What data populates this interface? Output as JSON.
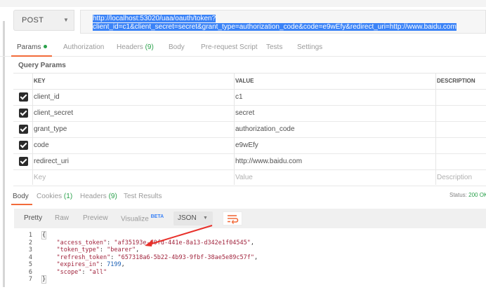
{
  "request": {
    "method": "POST",
    "url_line1": "http://localhost:53020/uaa/oauth/token?",
    "url_line2": "client_id=c1&client_secret=secret&grant_type=authorization_code&code=e9wEfy&redirect_uri=http://www.baidu.com"
  },
  "request_tabs": [
    {
      "label": "Params",
      "active": true,
      "dot": true
    },
    {
      "label": "Authorization"
    },
    {
      "label": "Headers",
      "count": "(9)"
    },
    {
      "label": "Body"
    },
    {
      "label": "Pre-request Script"
    },
    {
      "label": "Tests"
    },
    {
      "label": "Settings"
    }
  ],
  "query_params": {
    "title": "Query Params",
    "headers": {
      "key": "KEY",
      "value": "VALUE",
      "description": "DESCRIPTION"
    },
    "rows": [
      {
        "key": "client_id",
        "value": "c1"
      },
      {
        "key": "client_secret",
        "value": "secret"
      },
      {
        "key": "grant_type",
        "value": "authorization_code"
      },
      {
        "key": "code",
        "value": "e9wEfy"
      },
      {
        "key": "redirect_uri",
        "value": "http://www.baidu.com"
      }
    ],
    "placeholder": {
      "key": "Key",
      "value": "Value",
      "description": "Description"
    }
  },
  "response_tabs": [
    {
      "label": "Body",
      "active": true
    },
    {
      "label": "Cookies",
      "count": "(1)"
    },
    {
      "label": "Headers",
      "count": "(9)"
    },
    {
      "label": "Test Results"
    }
  ],
  "status": {
    "label": "Status:",
    "value": "200 OK"
  },
  "view_modes": [
    "Pretty",
    "Raw",
    "Preview",
    "Visualize"
  ],
  "visualize_badge": "BETA",
  "format": "JSON",
  "code_lines": [
    {
      "n": "1",
      "parts": [
        {
          "t": "{",
          "c": "p"
        }
      ]
    },
    {
      "n": "2",
      "parts": [
        {
          "t": "    ",
          "c": "p"
        },
        {
          "t": "\"access_token\"",
          "c": "k"
        },
        {
          "t": ": ",
          "c": "p"
        },
        {
          "t": "\"af35193e-60fd-441e-8a13-d342e1f04545\"",
          "c": "s"
        },
        {
          "t": ",",
          "c": "p"
        }
      ]
    },
    {
      "n": "3",
      "parts": [
        {
          "t": "    ",
          "c": "p"
        },
        {
          "t": "\"token_type\"",
          "c": "k"
        },
        {
          "t": ": ",
          "c": "p"
        },
        {
          "t": "\"bearer\"",
          "c": "s"
        },
        {
          "t": ",",
          "c": "p"
        }
      ]
    },
    {
      "n": "4",
      "parts": [
        {
          "t": "    ",
          "c": "p"
        },
        {
          "t": "\"refresh_token\"",
          "c": "k"
        },
        {
          "t": ": ",
          "c": "p"
        },
        {
          "t": "\"657318a6-5b22-4b93-9fbf-38ae5e89c57f\"",
          "c": "s"
        },
        {
          "t": ",",
          "c": "p"
        }
      ]
    },
    {
      "n": "5",
      "parts": [
        {
          "t": "    ",
          "c": "p"
        },
        {
          "t": "\"expires_in\"",
          "c": "k"
        },
        {
          "t": ": ",
          "c": "p"
        },
        {
          "t": "7199",
          "c": "n"
        },
        {
          "t": ",",
          "c": "p"
        }
      ]
    },
    {
      "n": "6",
      "parts": [
        {
          "t": "    ",
          "c": "p"
        },
        {
          "t": "\"scope\"",
          "c": "k"
        },
        {
          "t": ": ",
          "c": "p"
        },
        {
          "t": "\"all\"",
          "c": "s"
        }
      ]
    },
    {
      "n": "7",
      "parts": [
        {
          "t": "}",
          "c": "p"
        }
      ]
    }
  ],
  "colors": {
    "accent": "#f26b3a",
    "selection": "#3b83f7",
    "success": "#2aa14b",
    "annotation_arrow": "#e8302a"
  },
  "icons": {
    "method_caret": "chevron-down-icon",
    "format_caret": "chevron-down-icon",
    "wrap": "wrap-lines-icon",
    "checkbox": "checkbox-checked-icon"
  }
}
